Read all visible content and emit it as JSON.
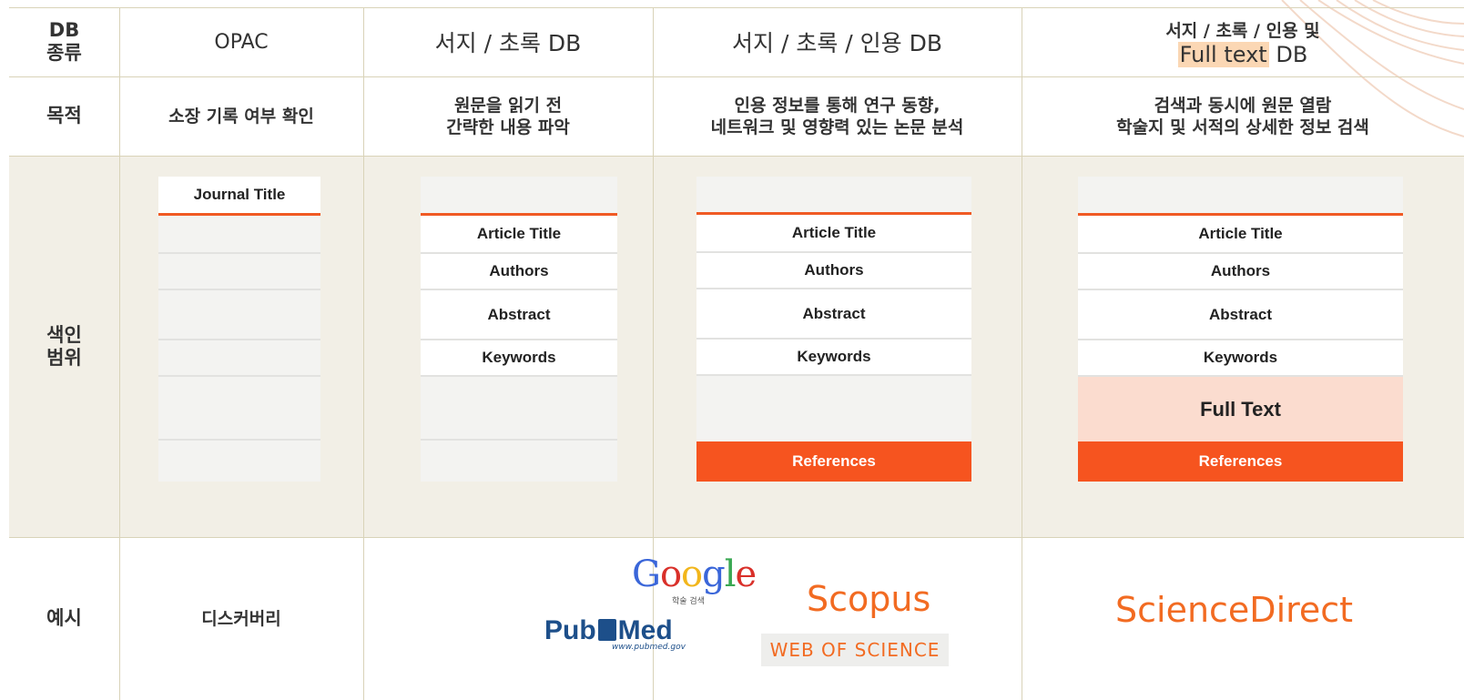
{
  "row_headers": {
    "db_type": [
      "DB",
      "종류"
    ],
    "purpose": "목적",
    "index_scope": [
      "색인",
      "범위"
    ],
    "example": "예시"
  },
  "columns": {
    "opac": "OPAC",
    "biblio_abstract": "서지 / 초록 DB",
    "biblio_abstract_citation": "서지 / 초록 / 인용 DB",
    "fulltext_line1": "서지 / 초록 / 인용 및",
    "fulltext_highlight": "Full text",
    "fulltext_suffix": "DB"
  },
  "purposes": {
    "opac": "소장 기록 여부 확인",
    "biblio_abstract": [
      "원문을 읽기 전",
      "간략한 내용 파악"
    ],
    "biblio_abstract_citation": [
      "인용 정보를 통해 연구 동향,",
      "네트워크 및 영향력 있는 논문 분석"
    ],
    "fulltext": [
      "검색과 동시에 원문 열람",
      "학술지 및 서적의 상세한 정보 검색"
    ]
  },
  "fields": {
    "journal_title": "Journal Title",
    "article_title": "Article Title",
    "authors": "Authors",
    "abstract": "Abstract",
    "keywords": "Keywords",
    "full_text": "Full Text",
    "references": "References"
  },
  "examples": {
    "opac": "디스커버리",
    "google": "Google",
    "google_sub": "학술 검색",
    "pubmed_pub": "Pub",
    "pubmed_med": "Med",
    "pubmed_url": "www.pubmed.gov",
    "scopus": "Scopus",
    "web_of_science": "WEB OF SCIENCE",
    "sciencedirect": "ScienceDirect"
  },
  "colors": {
    "accent_orange": "#f6541f",
    "fulltext_fill": "#fbdccf",
    "band": "#f2efe6",
    "grid": "#d9d3b8"
  }
}
